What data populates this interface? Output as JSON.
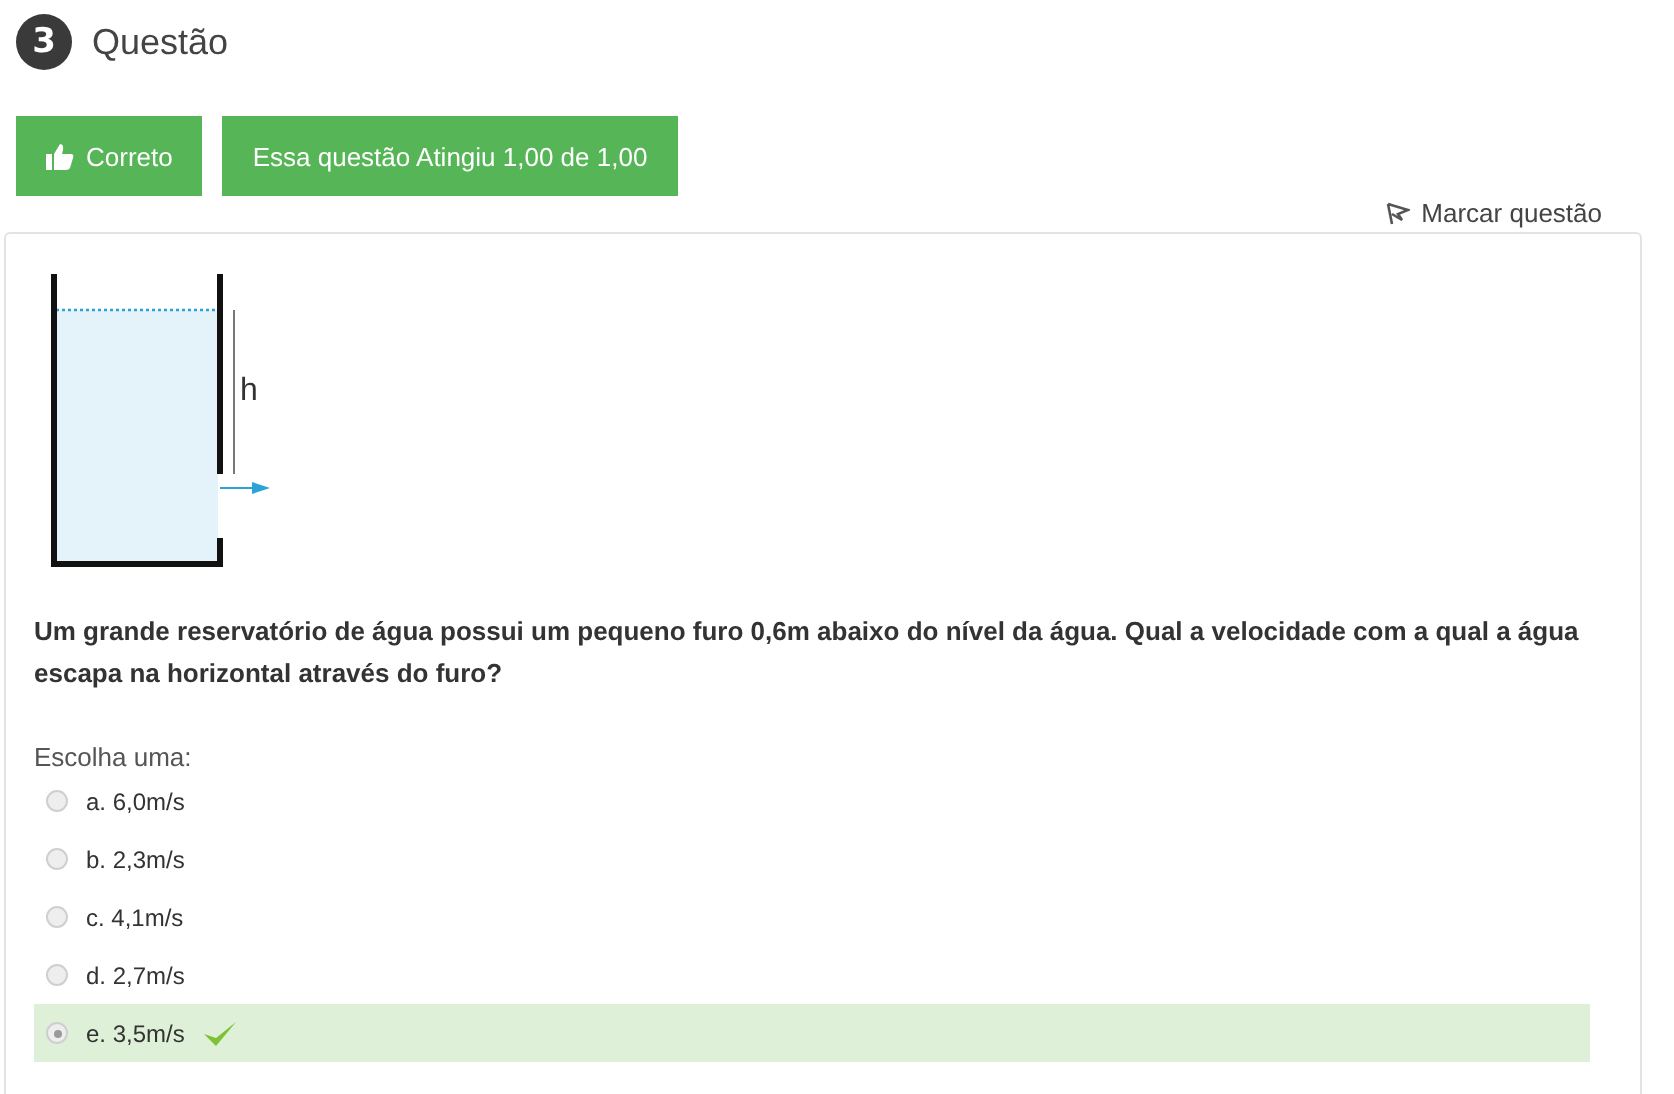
{
  "question": {
    "number": "3",
    "title": "Questão"
  },
  "status_buttons": [
    {
      "kind": "icon",
      "label": "Correto"
    },
    {
      "kind": "plain",
      "label": "Essa questão Atingiu 1,00 de 1,00"
    }
  ],
  "flag": {
    "label": "Marcar questão"
  },
  "diagram": {
    "label": "h"
  },
  "prompt": "Um grande reservatório de água possui um pequeno furo 0,6m abaixo do nível da água. Qual a velocidade com a qual a água escapa na horizontal através do furo?",
  "choose_label": "Escolha uma:",
  "options": [
    {
      "label": "a. 6,0m/s",
      "selected": false,
      "correct": false
    },
    {
      "label": "b. 2,3m/s",
      "selected": false,
      "correct": false
    },
    {
      "label": "c. 4,1m/s",
      "selected": false,
      "correct": false
    },
    {
      "label": "d. 2,7m/s",
      "selected": false,
      "correct": false
    },
    {
      "label": "e. 3,5m/s",
      "selected": true,
      "correct": true
    }
  ]
}
